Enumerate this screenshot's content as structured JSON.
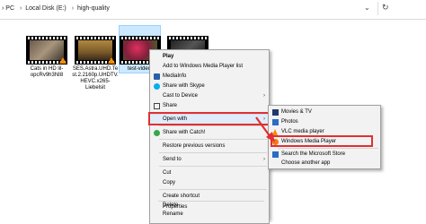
{
  "address": {
    "crumbs": [
      "› PC",
      "Local Disk (E:)",
      "high-quality"
    ],
    "separator": "›"
  },
  "files": [
    {
      "name": "Cats in HD lil-opcRv9h3NI8"
    },
    {
      "name": "SES.Astra.UHD.Test.2.2160p.UHDTV.HEVC.x265-Liebelsit"
    },
    {
      "name": "test-video"
    },
    {
      "name": ""
    }
  ],
  "context_menu": {
    "items": [
      {
        "label": "Play"
      },
      {
        "label": "Add to Windows Media Player list"
      },
      {
        "label": "MediaInfo"
      },
      {
        "label": "Share with Skype"
      },
      {
        "label": "Cast to Device"
      },
      {
        "label": "Share"
      },
      {
        "label": "Open with"
      },
      {
        "label": "Share with Catch!"
      },
      {
        "label": "Restore previous versions"
      },
      {
        "label": "Send to"
      },
      {
        "label": "Cut"
      },
      {
        "label": "Copy"
      },
      {
        "label": "Create shortcut"
      },
      {
        "label": "Delete"
      },
      {
        "label": "Rename"
      },
      {
        "label": "Properties"
      }
    ]
  },
  "open_with_menu": {
    "items": [
      {
        "label": "Movies & TV"
      },
      {
        "label": "Photos"
      },
      {
        "label": "VLC media player"
      },
      {
        "label": "Windows Media Player"
      },
      {
        "label": "Search the Microsoft Store"
      },
      {
        "label": "Choose another app"
      }
    ]
  },
  "colors": {
    "highlight_box": "#e03030",
    "selection": "#cce8ff",
    "vlc": "#f28c00"
  }
}
